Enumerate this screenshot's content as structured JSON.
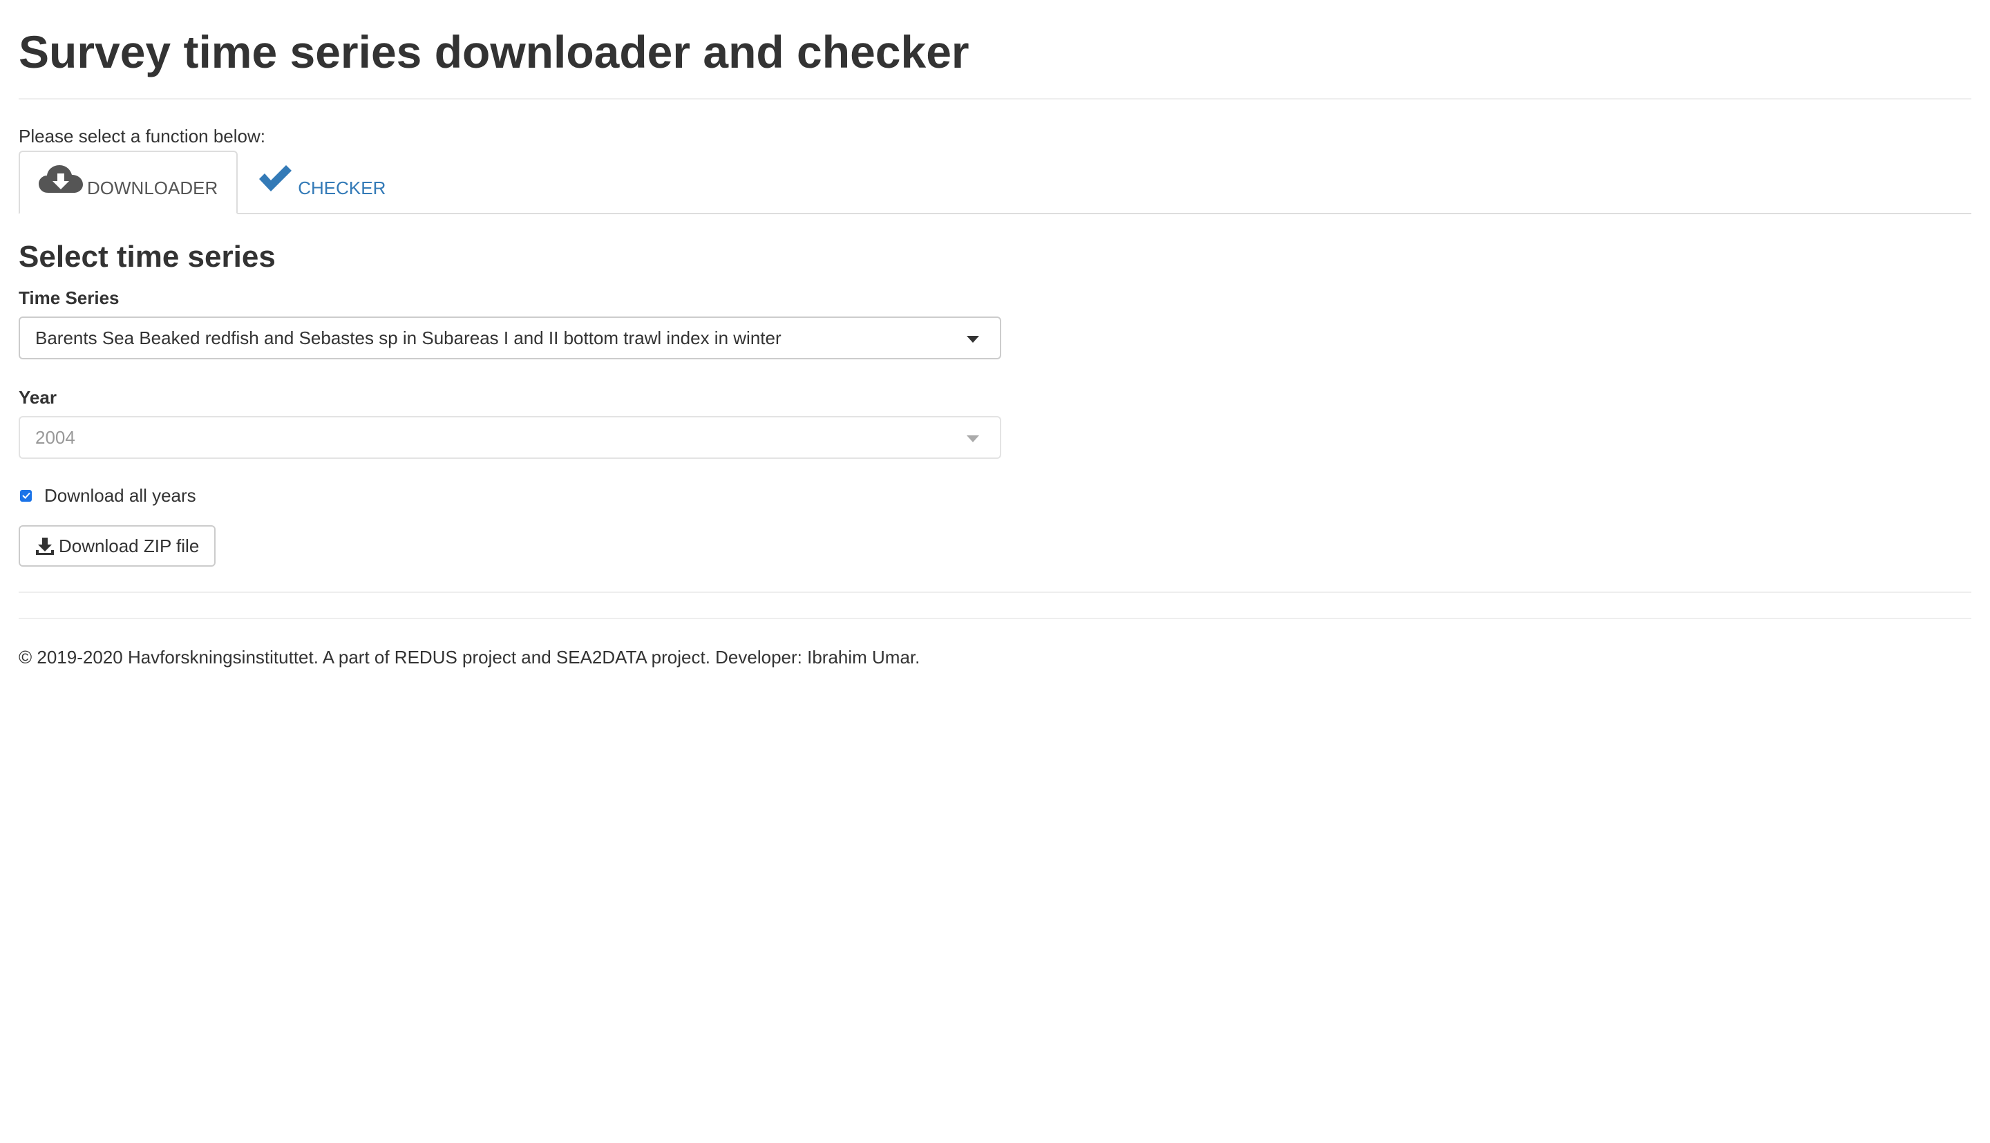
{
  "page": {
    "title": "Survey time series downloader and checker",
    "prompt": "Please select a function below:"
  },
  "tabs": [
    {
      "label": "DOWNLOADER",
      "icon": "cloud-download-icon",
      "active": true
    },
    {
      "label": "CHECKER",
      "icon": "checkmark-icon",
      "active": false
    }
  ],
  "downloader": {
    "section_title": "Select time series",
    "time_series": {
      "label": "Time Series",
      "selected": "Barents Sea Beaked redfish and Sebastes sp in Subareas I and II bottom trawl index in winter"
    },
    "year": {
      "label": "Year",
      "selected": "2004",
      "disabled": true
    },
    "download_all": {
      "label": "Download all years",
      "checked": true
    },
    "download_button": {
      "label": "Download ZIP file",
      "icon": "download-icon"
    }
  },
  "footer": {
    "text": "© 2019-2020 Havforskningsinstituttet. A part of REDUS project and SEA2DATA project. Developer: Ibrahim Umar."
  },
  "colors": {
    "link": "#337ab7",
    "checkbox": "#1a73e8",
    "text": "#333333"
  }
}
